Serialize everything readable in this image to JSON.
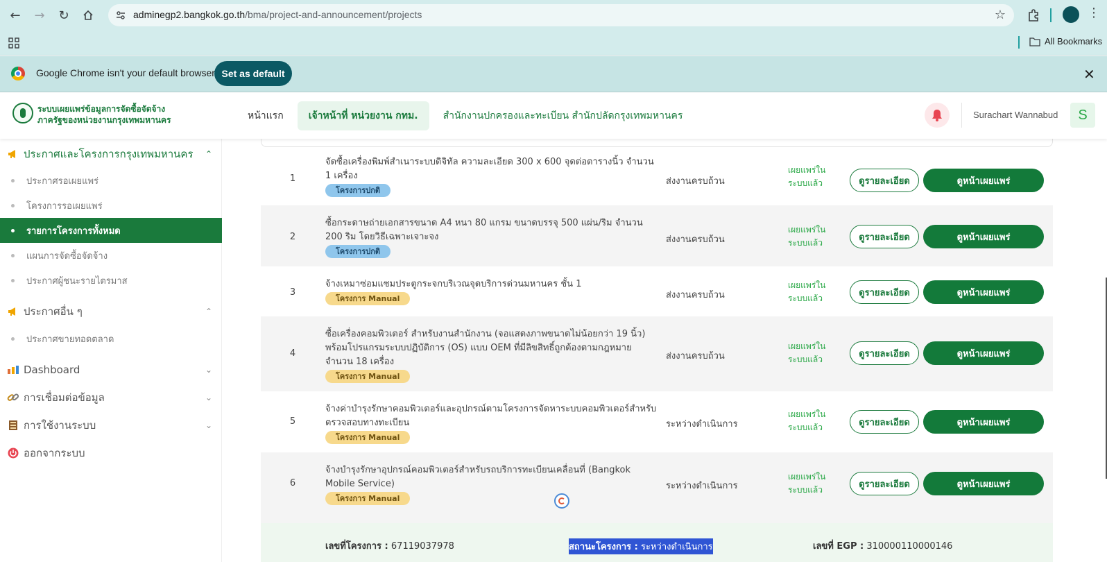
{
  "browser": {
    "url_host": "adminegp2.bangkok.go.th",
    "url_path": "/bma/project-and-announcement/projects",
    "all_bookmarks": "All Bookmarks",
    "infobar_text": "Google Chrome isn't your default browser",
    "set_default": "Set as default"
  },
  "header": {
    "logo_line1": "ระบบเผยแพร่ข้อมูลการจัดซื้อจัดจ้าง",
    "logo_line2": "ภาครัฐของหน่วยงานกรุงเทพมหานคร",
    "nav_home": "หน้าแรก",
    "nav_active": "เจ้าหน้าที่ หน่วยงาน กทม.",
    "nav_org": "สำนักงานปกครองและทะเบียน สำนักปลัดกรุงเทพมหานคร",
    "user_name": "Surachart Wannabud",
    "avatar_letter": "S"
  },
  "sidebar": {
    "group1": {
      "label": "ประกาศและโครงการกรุงเทพมหานคร",
      "icon": "megaphone-icon"
    },
    "group1_items": [
      "ประกาศรอเผยแพร่",
      "โครงการรอเผยแพร่",
      "รายการโครงการทั้งหมด",
      "แผนการจัดซื้อจัดจ้าง",
      "ประกาศผู้ชนะรายไตรมาส"
    ],
    "group2": {
      "label": "ประกาศอื่น ๆ",
      "icon": "megaphone-icon"
    },
    "group2_items": [
      "ประกาศขายทอดตลาด"
    ],
    "dashboard": "Dashboard",
    "connect": "การเชื่อมต่อข้อมูล",
    "usage": "การใช้งานระบบ",
    "logout": "ออกจากระบบ"
  },
  "table": {
    "detail_label": "ดูรายละเอียด",
    "publish_label": "ดูหน้าเผยแพร่",
    "pub_status_line1": "เผยแพร่ใน",
    "pub_status_line2": "ระบบแล้ว",
    "rows": [
      {
        "num": "1",
        "title": "จัดซื้อเครื่องพิมพ์สำเนาระบบดิจิทัล ความละเอียด 300 x 600 จุดต่อตารางนิ้ว จำนวน 1 เครื่อง",
        "badge": "โครงการปกติ",
        "status": "ส่งงานครบถ้วน"
      },
      {
        "num": "2",
        "title": "ซื้อกระดาษถ่ายเอกสารขนาด A4 หนา 80 แกรม ขนาดบรรจุ 500 แผ่น/ริม จำนวน 200 ริม โดยวิธีเฉพาะเจาะจง",
        "badge": "โครงการปกติ",
        "status": "ส่งงานครบถ้วน"
      },
      {
        "num": "3",
        "title": "จ้างเหมาซ่อมแซมประตูกระจกบริเวณจุดบริการด่วนมหานคร ชั้น 1",
        "badge": "โครงการ Manual",
        "status": "ส่งงานครบถ้วน"
      },
      {
        "num": "4",
        "title": "ซื้อเครื่องคอมพิวเตอร์ สำหรับงานสำนักงาน (จอแสดงภาพขนาดไม่น้อยกว่า 19 นิ้ว) พร้อมโปรแกรมระบบปฏิบัติการ (OS) แบบ OEM ที่มีลิขสิทธิ์ถูกต้องตามกฎหมาย จำนวน 18 เครื่อง",
        "badge": "โครงการ Manual",
        "status": "ส่งงานครบถ้วน"
      },
      {
        "num": "5",
        "title": "จ้างค่าบำรุงรักษาคอมพิวเตอร์และอุปกรณ์ตามโครงการจัดหาระบบคอมพิวเตอร์สำหรับตรวจสอบทางทะเบียน",
        "badge": "โครงการ Manual",
        "status": "ระหว่างดำเนินการ"
      },
      {
        "num": "6",
        "title": "จ้างบำรุงรักษาอุปกรณ์คอมพิวเตอร์สำหรับรถบริการทะเบียนเคลื่อนที่ (Bangkok Mobile Service)",
        "badge": "โครงการ Manual",
        "status": "ระหว่างดำเนินการ"
      }
    ]
  },
  "detail": {
    "project_no_label": "เลขที่โครงการ :",
    "project_no": "67119037978",
    "project_status_label": "สถานะโครงการ :",
    "project_status": "ระหว่างดำเนินการ",
    "egp_label": "เลขที่ EGP :",
    "egp_no": "310000110000146"
  },
  "colors": {
    "primary_green": "#1a7a3c",
    "badge_normal": "#8fc6ec",
    "badge_manual": "#f7d98c",
    "chrome_teal": "#d3ecec"
  }
}
